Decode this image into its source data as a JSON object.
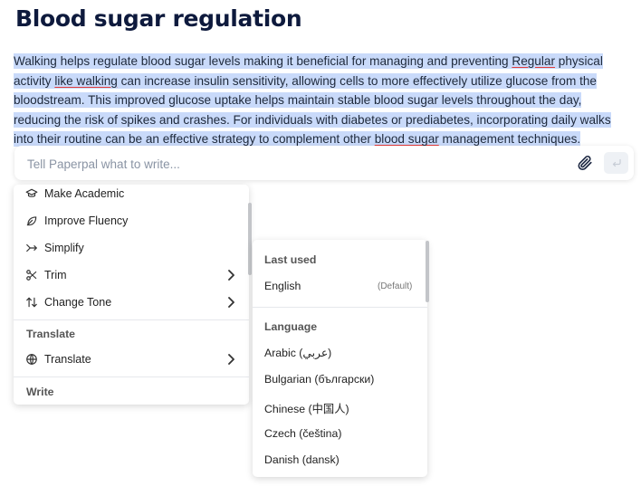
{
  "document": {
    "title": "Blood sugar regulation",
    "paragraph_parts": [
      "Walking helps regulate blood sugar levels making it beneficial for managing and preventing ",
      "Regular",
      " physical activity ",
      "like walking",
      " can increase insulin sensitivity, allowing cells to more effectively utilize glucose from the bloodstream. This improved glucose uptake helps maintain stable blood sugar levels throughout the day, reducing the risk of spikes and crashes. For individuals with diabetes or prediabetes, incorporating daily walks into their routine can be an effective strategy to complement other ",
      "blood sugar",
      " management techniques."
    ]
  },
  "prompt": {
    "placeholder": "Tell Paperpal what to write...",
    "attach_icon": "paperclip-icon",
    "send_icon": "enter-icon"
  },
  "actions_menu": {
    "items": [
      {
        "label": "Make Academic",
        "icon": "graduation-cap-icon",
        "has_submenu": false
      },
      {
        "label": "Improve Fluency",
        "icon": "leaf-icon",
        "has_submenu": false
      },
      {
        "label": "Simplify",
        "icon": "simplify-arrow-icon",
        "has_submenu": false
      },
      {
        "label": "Trim",
        "icon": "scissors-icon",
        "has_submenu": true
      },
      {
        "label": "Change Tone",
        "icon": "swap-arrows-icon",
        "has_submenu": true
      }
    ],
    "translate_section": "Translate",
    "translate_item": {
      "label": "Translate",
      "icon": "globe-icon",
      "has_submenu": true
    },
    "write_section": "Write"
  },
  "language_menu": {
    "last_used_heading": "Last used",
    "last_used": {
      "label": "English",
      "tag": "(Default)"
    },
    "language_heading": "Language",
    "languages": [
      "Arabic (عربي)",
      "Bulgarian (български)",
      "Chinese (中国人)",
      "Czech (čeština)",
      "Danish (dansk)"
    ]
  },
  "colors": {
    "selection": "#c9dafa",
    "title": "#0e1a3d",
    "spell_underline": "#e23b3b"
  }
}
